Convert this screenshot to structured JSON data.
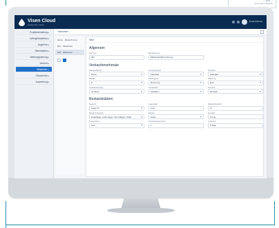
{
  "app": {
    "brand": "Visen Cloud",
    "brand_sub": "powered by Visen",
    "user": "Email Adresse"
  },
  "corner_note": [
    "— 2020 —",
    "www.visen-cloud.de"
  ],
  "sidebar": {
    "items": [
      {
        "label": "Projektverwaltung ▸",
        "active": false
      },
      {
        "label": "Liefergebäudebau ▸",
        "active": false
      },
      {
        "label": "Angebote ▸",
        "active": false
      },
      {
        "label": "Stammdaten ▸",
        "active": false
      },
      {
        "label": "Wartungsplanung ▸",
        "active": false
      },
      {
        "label": "Vertrieb ▸",
        "active": false
      },
      {
        "label": "Mitarbeiter ▸",
        "active": true
      },
      {
        "label": "Dokumente ▸",
        "active": false
      },
      {
        "label": "Auswertung ▸",
        "active": false
      }
    ]
  },
  "crumb": "Mitarbeiter",
  "tree": {
    "rows": [
      {
        "id": "Name",
        "label": "Bezeichnung",
        "sel": false
      },
      {
        "id": "001",
        "label": "Mitarbeiter",
        "sel": false
      },
      {
        "id": "002",
        "label": "Mitarbeiter",
        "sel": true
      }
    ]
  },
  "form": {
    "top": "Mitar",
    "section1": "Allgemein",
    "s1_fields": [
      {
        "label": "Nummer",
        "value": "002"
      },
      {
        "label": "Bezeichnung",
        "value": "Mitarbeiter/Bezeichnung"
      }
    ],
    "section2": "Verkaufsmerkmale",
    "s2_fields": [
      {
        "label": "Verkaufskanal",
        "value": "Privat",
        "sel": true
      },
      {
        "label": "Kundengruppe",
        "value": "Standard",
        "sel": true
      },
      {
        "label": "Preisliste",
        "value": "Standard",
        "sel": true
      },
      {
        "label": "Rabatt",
        "value": "0",
        "sel": true
      },
      {
        "label": "Zahlungsart",
        "value": "Rechnung",
        "sel": true
      },
      {
        "label": "Währung",
        "value": "Euro",
        "sel": true
      },
      {
        "label": "Lieferbedingung",
        "value": "Ab Werk",
        "sel": true
      },
      {
        "label": "Versandart",
        "value": "Spedition",
        "sel": true
      },
      {
        "label": "Sprache",
        "value": "Deutsch",
        "sel": true
      }
    ],
    "section3": "Bestandsdaten",
    "s3_fields": [
      {
        "label": "Lagerort",
        "value": "Lager 01",
        "sel": true
      },
      {
        "label": "Lagerplatz",
        "value": "A-01",
        "sel": false
      },
      {
        "label": "Mindestbestand",
        "value": "10",
        "sel": false
      },
      {
        "label": "Bestand Gesamt",
        "value": "Hauptlager, Außenlager, Zentrallager, Filiale",
        "sel": true
      },
      {
        "label": "Einheit",
        "value": "Stück",
        "sel": true
      },
      {
        "label": "Gewicht",
        "value": "0,5 kg",
        "sel": false
      },
      {
        "label": "Kommission",
        "value": "Nein",
        "sel": true
      },
      {
        "label": "Verpackungseinheit",
        "value": "1",
        "sel": false
      },
      {
        "label": "Lieferzeit",
        "value": "5 Tage",
        "sel": false
      }
    ]
  }
}
